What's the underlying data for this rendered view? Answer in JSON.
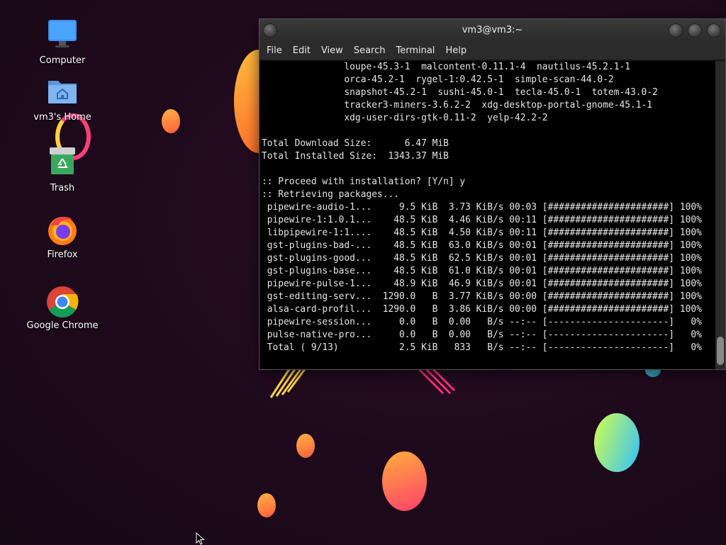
{
  "desktop": {
    "icons": [
      {
        "label": "Computer"
      },
      {
        "label": "vm3's Home"
      },
      {
        "label": "Trash"
      },
      {
        "label": "Firefox"
      },
      {
        "label": "Google Chrome"
      }
    ]
  },
  "window": {
    "title": "vm3@vm3:~",
    "menu": [
      "File",
      "Edit",
      "View",
      "Search",
      "Terminal",
      "Help"
    ]
  },
  "terminal": {
    "lines": [
      "               loupe-45.3-1  malcontent-0.11.1-4  nautilus-45.2.1-1",
      "               orca-45.2-1  rygel-1:0.42.5-1  simple-scan-44.0-2",
      "               snapshot-45.2-1  sushi-45.0-1  tecla-45.0-1  totem-43.0-2",
      "               tracker3-miners-3.6.2-2  xdg-desktop-portal-gnome-45.1-1",
      "               xdg-user-dirs-gtk-0.11-2  yelp-42.2-2",
      "",
      "Total Download Size:      6.47 MiB",
      "Total Installed Size:  1343.37 MiB",
      "",
      ":: Proceed with installation? [Y/n] y",
      ":: Retrieving packages...",
      " pipewire-audio-1...     9.5 KiB  3.73 KiB/s 00:03 [######################] 100%",
      " pipewire-1:1.0.1...    48.5 KiB  4.46 KiB/s 00:11 [######################] 100%",
      " libpipewire-1:1....    48.5 KiB  4.50 KiB/s 00:11 [######################] 100%",
      " gst-plugins-bad-...    48.5 KiB  63.0 KiB/s 00:01 [######################] 100%",
      " gst-plugins-good...    48.5 KiB  62.5 KiB/s 00:01 [######################] 100%",
      " gst-plugins-base...    48.5 KiB  61.0 KiB/s 00:01 [######################] 100%",
      " pipewire-pulse-1...    48.9 KiB  46.9 KiB/s 00:01 [######################] 100%",
      " gst-editing-serv...  1290.0   B  3.77 KiB/s 00:00 [######################] 100%",
      " alsa-card-profil...  1290.0   B  3.86 KiB/s 00:00 [######################] 100%",
      " pipewire-session...     0.0   B  0.00   B/s --:-- [----------------------]   0%",
      " pulse-native-pro...     0.0   B  0.00   B/s --:-- [----------------------]   0%",
      " Total ( 9/13)           2.5 KiB   833   B/s --:-- [----------------------]   0%"
    ]
  },
  "colors": {
    "desktop_bg": "#1e0a1c",
    "terminal_bg": "#000000",
    "terminal_fg": "#e6e6e6"
  },
  "icon_names": [
    "computer-icon",
    "home-folder-icon",
    "trash-icon",
    "firefox-icon",
    "chrome-icon",
    "mouse-cursor-icon"
  ]
}
